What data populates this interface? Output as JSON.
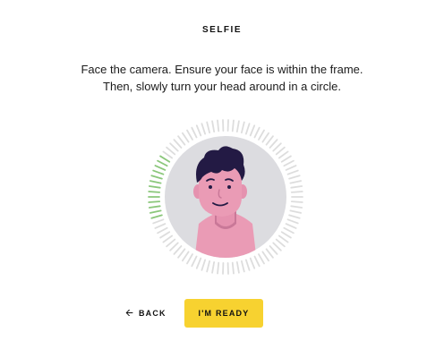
{
  "header": {
    "title": "SELFIE"
  },
  "instructions": {
    "line1": "Face the camera. Ensure your face is within the frame.",
    "line2": "Then, slowly turn your head around in a circle."
  },
  "camera": {
    "progress_fraction": 0.14,
    "icons": {
      "avatar": "face-illustration-icon"
    },
    "colors": {
      "tick_inactive": "#dddddd",
      "tick_active": "#8bc77b",
      "frame_bg": "#dcdce0",
      "skin": "#ea9bb5",
      "hair": "#231a44"
    }
  },
  "actions": {
    "back_icon": "arrow-left-icon",
    "back_label": "BACK",
    "ready_label": "I'M READY",
    "ready_color": "#f7d230"
  }
}
